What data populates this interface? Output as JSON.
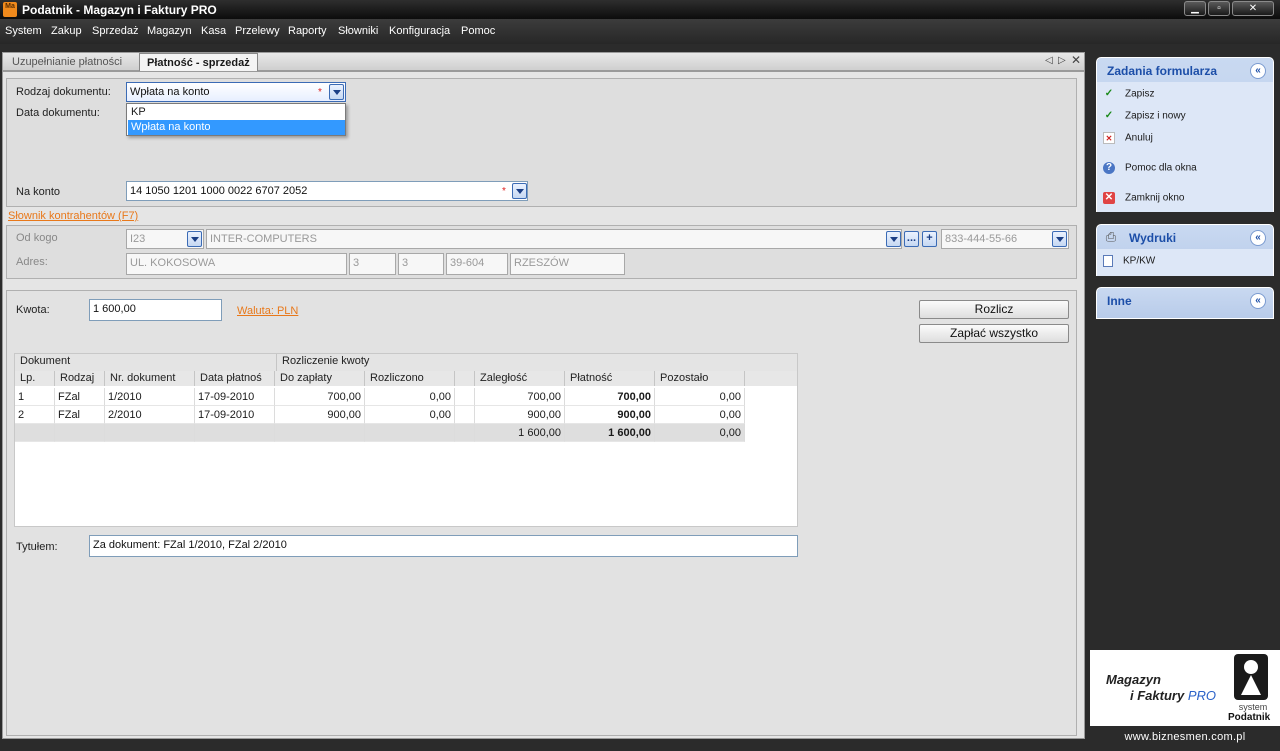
{
  "window": {
    "title": "Podatnik - Magazyn i Faktury PRO",
    "logo_text": "Ma",
    "controls": [
      "minimize",
      "maximize",
      "close"
    ]
  },
  "menu": [
    "System",
    "Zakup",
    "Sprzedaż",
    "Magazyn",
    "Kasa",
    "Przelewy",
    "Raporty",
    "Słowniki",
    "Konfiguracja",
    "Pomoc"
  ],
  "tabs": [
    {
      "label": "Uzupełnianie płatności",
      "active": false
    },
    {
      "label": "Płatność - sprzedaż",
      "active": true
    }
  ],
  "form": {
    "doc_type_label": "Rodzaj dokumentu:",
    "doc_type_value": "Wpłata na konto",
    "doc_type_options": [
      "KP",
      "Wpłata na konto"
    ],
    "doc_date_label": "Data dokumentu:",
    "account_label": "Na konto",
    "account_value": "14 1050 1201 1000 0022 6707 2052",
    "contractors_link": "Słownik kontrahentów (F7)",
    "from_label": "Od kogo",
    "from_code": "I23",
    "from_name": "INTER-COMPUTERS",
    "from_phone": "833-444-55-66",
    "more_btn": "...",
    "add_btn": "+",
    "address_label": "Adres:",
    "address_street": "UL. KOKOSOWA",
    "address_no1": "3",
    "address_no2": "3",
    "address_zip": "39-604",
    "address_city": "RZESZÓW",
    "amount_label": "Kwota:",
    "amount_value": "1 600,00",
    "currency_link": "Waluta: PLN",
    "settle_btn": "Rozlicz",
    "pay_all_btn": "Zapłać wszystko",
    "title_label": "Tytułem:",
    "title_value": "Za dokument: FZal 1/2010, FZal 2/2010"
  },
  "grid": {
    "group_headers": [
      "Dokument",
      "Rozliczenie kwoty"
    ],
    "columns": [
      "Lp.",
      "Rodzaj",
      "Nr. dokument",
      "Data płatnoś",
      "Do zapłaty",
      "Rozliczono",
      "",
      "Zaległość",
      "Płatność",
      "Pozostało"
    ],
    "rows": [
      [
        "1",
        "FZal",
        "1/2010",
        "17-09-2010",
        "700,00",
        "0,00",
        "",
        "700,00",
        "700,00",
        "0,00"
      ],
      [
        "2",
        "FZal",
        "2/2010",
        "17-09-2010",
        "900,00",
        "0,00",
        "",
        "900,00",
        "900,00",
        "0,00"
      ]
    ],
    "totals": [
      "",
      "",
      "",
      "",
      "",
      "",
      "",
      "1 600,00",
      "1 600,00",
      "0,00"
    ]
  },
  "side": {
    "tasks_title": "Zadania formularza",
    "tasks": [
      {
        "label": "Zapisz",
        "icon": "check-icon"
      },
      {
        "label": "Zapisz i nowy",
        "icon": "check-icon"
      },
      {
        "label": "Anuluj",
        "icon": "cancel-icon"
      },
      {
        "label": "Pomoc dla okna",
        "icon": "help-icon"
      },
      {
        "label": "Zamknij okno",
        "icon": "close-window-icon"
      }
    ],
    "prints_title": "Wydruki",
    "prints": [
      {
        "label": "KP/KW",
        "icon": "document-icon"
      }
    ],
    "other_title": "Inne",
    "collapse_glyph": "«"
  },
  "brand": {
    "line1": "Magazyn",
    "line2": "i Faktury",
    "pro": "PRO",
    "system": "system",
    "podatnik": "Podatnik",
    "url": "www.biznesmen.com.pl"
  },
  "colors": {
    "accent": "#3399ff",
    "link": "#e8781a",
    "panel": "#c9d9f1",
    "required": "#e02020"
  }
}
